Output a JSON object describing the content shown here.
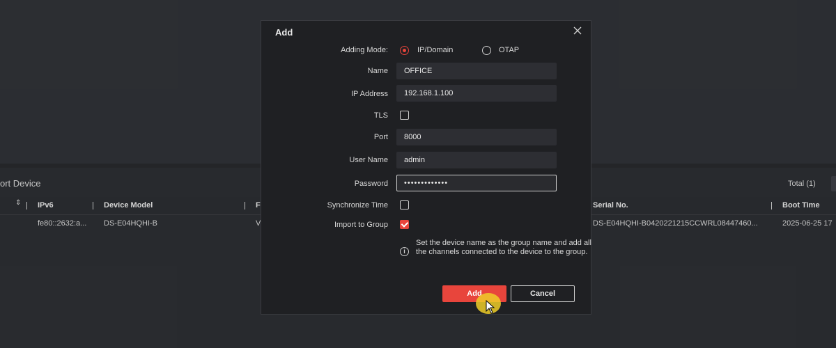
{
  "background": {
    "panel_title": "ort Device",
    "total_label": "Total (1)",
    "table": {
      "headers": [
        "IPv6",
        "Device Model",
        "F",
        "Serial No.",
        "Boot Time"
      ],
      "row": [
        "fe80::2632:a...",
        "DS-E04HQHI-B",
        "V",
        "DS-E04HQHI-B0420221215CCWRL08447460...",
        "2025-06-25 17"
      ]
    }
  },
  "dialog": {
    "title": "Add",
    "adding_mode": {
      "label": "Adding Mode:",
      "options": [
        "IP/Domain",
        "OTAP"
      ],
      "selected": "IP/Domain"
    },
    "fields": {
      "name": {
        "label": "Name",
        "value": "OFFICE"
      },
      "ip": {
        "label": "IP Address",
        "value": "192.168.1.100"
      },
      "tls": {
        "label": "TLS",
        "checked": false
      },
      "port": {
        "label": "Port",
        "value": "8000"
      },
      "username": {
        "label": "User Name",
        "value": "admin"
      },
      "password": {
        "label": "Password",
        "value": "•••••••••••••"
      },
      "sync_time": {
        "label": "Synchronize Time",
        "checked": false
      },
      "import_group": {
        "label": "Import to Group",
        "checked": true
      }
    },
    "info_text": "Set the device name as the group name and add all the channels connected to the device to the group.",
    "buttons": {
      "add": "Add",
      "cancel": "Cancel"
    }
  },
  "colors": {
    "accent": "#e8453c",
    "dialog_bg": "#1f2023",
    "field_bg": "#2d2e33",
    "page_bg": "#2b2d31"
  }
}
